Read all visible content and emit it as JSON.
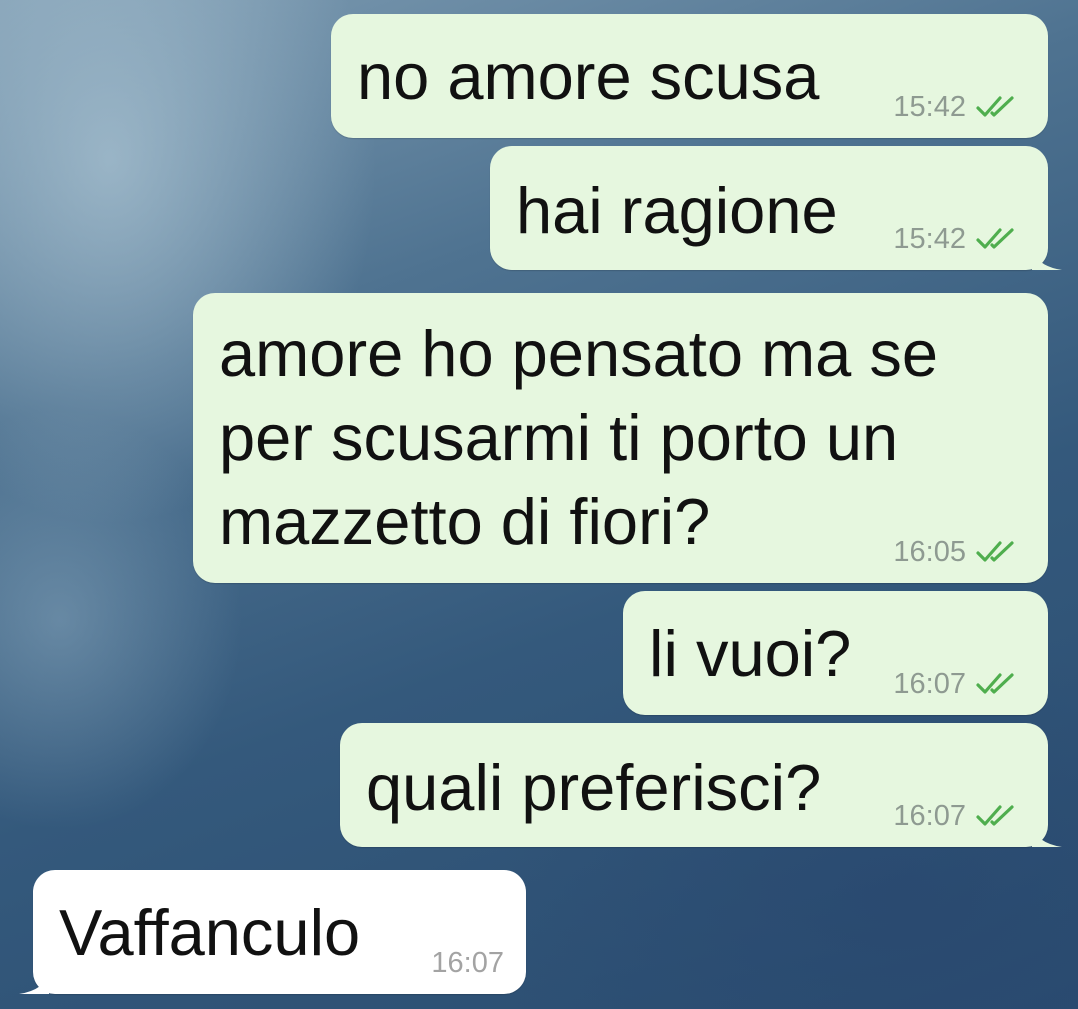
{
  "messages": [
    {
      "text": "no amore scusa",
      "time": "15:42",
      "status_icon": "double-check-icon",
      "direction": "outgoing"
    },
    {
      "text": "hai ragione",
      "time": "15:42",
      "status_icon": "double-check-icon",
      "direction": "outgoing"
    },
    {
      "lines": [
        "amore ho pensato ma se",
        "per scusarmi ti porto un",
        "mazzetto di fiori?"
      ],
      "time": "16:05",
      "status_icon": "double-check-icon",
      "direction": "outgoing"
    },
    {
      "text": "li vuoi?",
      "time": "16:07",
      "status_icon": "double-check-icon",
      "direction": "outgoing"
    },
    {
      "text": "quali preferisci?",
      "time": "16:07",
      "status_icon": "double-check-icon",
      "direction": "outgoing"
    },
    {
      "text": "Vaffanculo",
      "time": "16:07",
      "direction": "incoming"
    }
  ],
  "colors": {
    "outgoing_bubble": "#e6f7df",
    "incoming_bubble": "#ffffff",
    "read_tick": "#4fae4e",
    "timestamp": "#8e9a91"
  }
}
